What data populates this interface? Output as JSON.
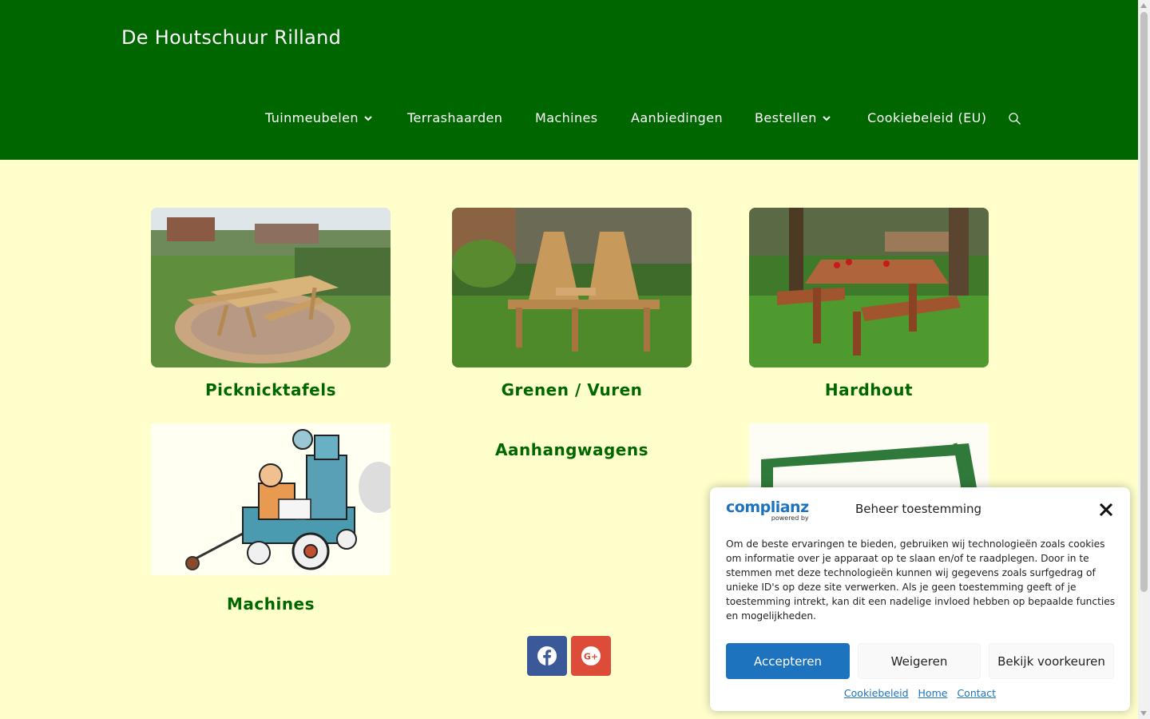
{
  "site": {
    "title": "De Houtschuur Rilland"
  },
  "nav": {
    "items": [
      {
        "label": "Tuinmeubelen",
        "has_dropdown": true
      },
      {
        "label": "Terrashaarden",
        "has_dropdown": false
      },
      {
        "label": "Machines",
        "has_dropdown": false
      },
      {
        "label": "Aanbiedingen",
        "has_dropdown": false
      },
      {
        "label": "Bestellen",
        "has_dropdown": true
      },
      {
        "label": "Cookiebeleid (EU)",
        "has_dropdown": false
      }
    ],
    "search_icon": "search-icon"
  },
  "cards": [
    {
      "title": "Picknicktafels"
    },
    {
      "title": "Grenen / Vuren"
    },
    {
      "title": "Hardhout"
    },
    {
      "title": "Machines"
    },
    {
      "title": "Aanhangwagens"
    }
  ],
  "social": {
    "facebook_icon": "facebook-icon",
    "google_plus_icon": "google-plus-icon"
  },
  "cookie_banner": {
    "logo_text": "complianz",
    "logo_sub": "powered by",
    "title": "Beheer toestemming",
    "text": "Om de beste ervaringen te bieden, gebruiken wij technologieën zoals cookies om informatie over je apparaat op te slaan en/of te raadplegen. Door in te stemmen met deze technologieën kunnen wij gegevens zoals surfgedrag of unieke ID's op deze site verwerken. Als je geen toestemming geeft of je toestemming intrekt, kan dit een nadelige invloed hebben op bepaalde functies en mogelijkheden.",
    "accept_label": "Accepteren",
    "deny_label": "Weigeren",
    "preferences_label": "Bekijk voorkeuren",
    "links": [
      "Cookiebeleid",
      "Home",
      "Contact"
    ]
  },
  "colors": {
    "header_bg": "#006600",
    "page_bg": "#ffffcc",
    "heading": "#006600",
    "accept_button": "#1e73be",
    "facebook": "#3b5998",
    "google_plus": "#dd4b39"
  }
}
